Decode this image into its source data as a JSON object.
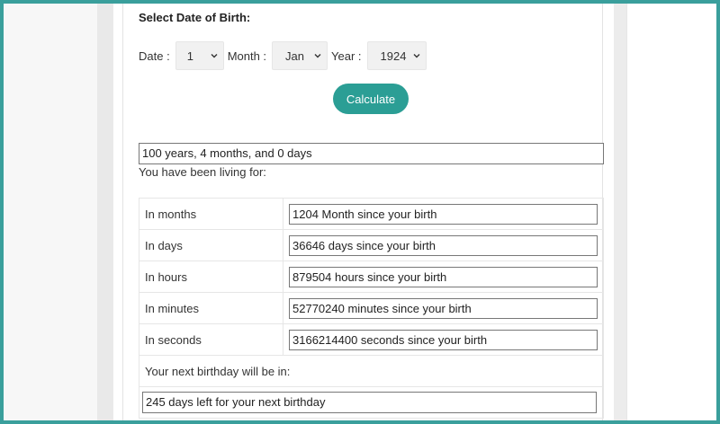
{
  "form": {
    "title": "Select Date of Birth:",
    "date_label": "Date :",
    "month_label": "Month :",
    "year_label": "Year :",
    "day_value": "1",
    "month_value": "Jan",
    "year_value": "1924",
    "calculate_label": "Calculate"
  },
  "result": {
    "age_text": "100 years, 4 months, and 0 days",
    "living_label": "You have been living for:"
  },
  "stats": [
    {
      "label": "In months",
      "value": "1204 Month since your birth"
    },
    {
      "label": "In days",
      "value": "36646 days since your birth"
    },
    {
      "label": "In hours",
      "value": "879504 hours since your birth"
    },
    {
      "label": "In minutes",
      "value": "52770240 minutes since your birth"
    },
    {
      "label": "In seconds",
      "value": "3166214400 seconds since your birth"
    }
  ],
  "next_birthday": {
    "label": "Your next birthday will be in:",
    "value": "245 days left for your next birthday"
  },
  "colors": {
    "frame": "#3a9f9c",
    "button": "#2b9e95"
  },
  "icons": {
    "select_arrow": "chevron-down-icon"
  }
}
